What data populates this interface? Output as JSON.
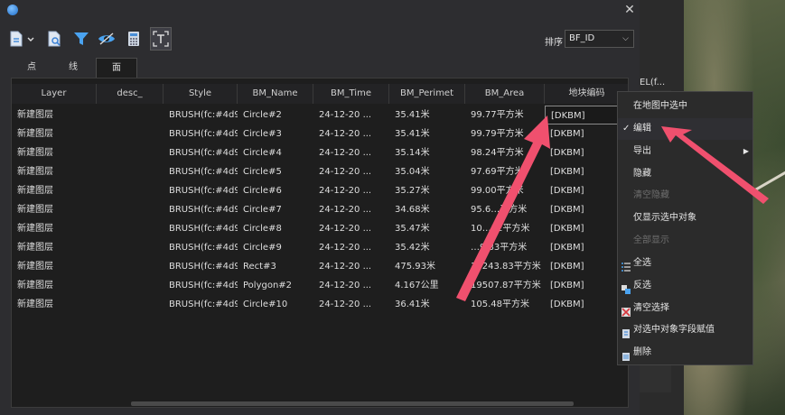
{
  "window": {
    "close_glyph": "✕"
  },
  "toolbar": {
    "buttons": [
      {
        "name": "export-doc-icon"
      },
      {
        "name": "zoom-doc-icon"
      },
      {
        "name": "filter-icon"
      },
      {
        "name": "eye-icon"
      },
      {
        "name": "calculator-icon"
      },
      {
        "name": "text-frame-icon"
      }
    ]
  },
  "sort": {
    "label": "排序",
    "selected": "BF_ID",
    "chevron": "⌵"
  },
  "tabs": [
    {
      "label": "点"
    },
    {
      "label": "线"
    },
    {
      "label": "面"
    }
  ],
  "active_tab": 2,
  "table": {
    "columns": [
      "Layer",
      "desc_",
      "Style",
      "BM_Name",
      "BM_Time",
      "BM_Perimet",
      "BM_Area",
      "地块编码"
    ],
    "rows": [
      [
        "新建图层",
        "",
        "BRUSH(fc:#4d9",
        "Circle#2",
        "24-12-20 ...",
        "35.41米",
        "99.77平方米",
        "[DKBM]"
      ],
      [
        "新建图层",
        "",
        "BRUSH(fc:#4d9",
        "Circle#3",
        "24-12-20 ...",
        "35.41米",
        "99.79平方米",
        "[DKBM]"
      ],
      [
        "新建图层",
        "",
        "BRUSH(fc:#4d9",
        "Circle#4",
        "24-12-20 ...",
        "35.14米",
        "98.24平方米",
        "[DKBM]"
      ],
      [
        "新建图层",
        "",
        "BRUSH(fc:#4d9",
        "Circle#5",
        "24-12-20 ...",
        "35.04米",
        "97.69平方米",
        "[DKBM]"
      ],
      [
        "新建图层",
        "",
        "BRUSH(fc:#4d9",
        "Circle#6",
        "24-12-20 ...",
        "35.27米",
        "99.00平方米",
        "[DKBM]"
      ],
      [
        "新建图层",
        "",
        "BRUSH(fc:#4d9",
        "Circle#7",
        "24-12-20 ...",
        "34.68米",
        "95.6…平方米",
        "[DKBM]"
      ],
      [
        "新建图层",
        "",
        "BRUSH(fc:#4d9",
        "Circle#8",
        "24-12-20 ...",
        "35.47米",
        "10…12平方米",
        "[DKBM]"
      ],
      [
        "新建图层",
        "",
        "BRUSH(fc:#4d9",
        "Circle#9",
        "24-12-20 ...",
        "35.42米",
        "…9.83平方米",
        "[DKBM]"
      ],
      [
        "新建图层",
        "",
        "BRUSH(fc:#4d9",
        "Rect#3",
        "24-12-20 ...",
        "475.93米",
        "13243.83平方米",
        "[DKBM]"
      ],
      [
        "新建图层",
        "",
        "BRUSH(fc:#4d9",
        "Polygon#2",
        "24-12-20 ...",
        "4.167公里",
        "19507.87平方米",
        "[DKBM]"
      ],
      [
        "新建图层",
        "",
        "BRUSH(fc:#4d9",
        "Circle#10",
        "24-12-20 ...",
        "36.41米",
        "105.48平方米",
        "[DKBM]"
      ]
    ]
  },
  "context_menu": {
    "items": [
      {
        "label": "在地图中选中",
        "disabled": false
      },
      {
        "label": "编辑",
        "disabled": false,
        "checked": true
      },
      {
        "label": "导出",
        "disabled": false,
        "submenu": true
      },
      {
        "label": "隐藏",
        "disabled": false
      },
      {
        "label": "清空隐藏",
        "disabled": true
      },
      {
        "label": "仅显示选中对象",
        "disabled": false
      },
      {
        "label": "全部显示",
        "disabled": true
      },
      {
        "label": "全选",
        "disabled": false,
        "icon": "select-all-icon"
      },
      {
        "label": "反选",
        "disabled": false,
        "icon": "invert-selection-icon"
      },
      {
        "label": "清空选择",
        "disabled": false,
        "icon": "clear-selection-icon"
      },
      {
        "label": "对选中对象字段赋值",
        "disabled": false,
        "icon": "assign-field-icon"
      },
      {
        "label": "删除",
        "disabled": false,
        "icon": "delete-icon"
      }
    ],
    "check_glyph": "✓",
    "submenu_glyph": "▶"
  },
  "side_panel": {
    "partial_text": "EL(f..."
  },
  "colors": {
    "annotation_arrow": "#f0506e",
    "dialog_bg": "#2d2d30",
    "grid_bg": "#1e1e1e"
  }
}
